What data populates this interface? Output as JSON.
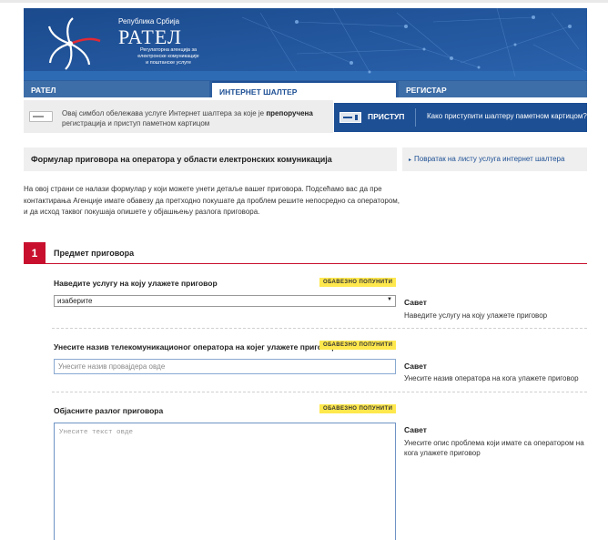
{
  "header": {
    "republic": "Република Србија",
    "agency_name": "РАТЕЛ",
    "agency_sub": [
      "Регулаторна агенција за",
      "електронске комуникације",
      "и поштанске услуге"
    ]
  },
  "tabs": [
    {
      "label": "РАТЕЛ"
    },
    {
      "label": "ИНТЕРНЕТ ШАЛТЕР"
    },
    {
      "label": "РЕГИСТАР"
    }
  ],
  "infobar": {
    "text_a": "Овај симбол обележава услуге Интернет шалтера за које је ",
    "text_bold": "препоручена",
    "text_b": " регистрација и приступ паметном картицом"
  },
  "login": {
    "button": "ПРИСТУП",
    "help": "Како приступити шалтеру паметном картицом?"
  },
  "page": {
    "title": "Формулар приговора на оператора у области електронских комуникација",
    "back_link": "Повратак на листу услуга интернет шалтера",
    "intro": "На овој страни се налази формулар у који можете унети детаље вашег приговора. Подсећамо вас да пре контактирања Агенције имате обавезу да претходно покушате да проблем решите непосредно са оператором, и да исход таквог покушаја опишете у објашњењу разлога приговора."
  },
  "section": {
    "number": "1",
    "title": "Предмет приговора"
  },
  "required_badge": "ОБАВЕЗНО ПОПУНИТИ",
  "fields": {
    "service": {
      "label": "Наведите услугу на коју улажете приговор",
      "selected": "изаберите",
      "tip_title": "Савет",
      "tip": "Наведите услугу на коју улажете приговор"
    },
    "operator": {
      "label": "Унесите назив телекомуникационог оператора на којег улажете приговор",
      "placeholder": "Унесите назив провајдера овде",
      "tip_title": "Савет",
      "tip": "Унесите назив оператора на кога улажете приговор"
    },
    "reason": {
      "label": "Објасните разлог приговора",
      "placeholder": "Унесите текст овде",
      "tip_title": "Савет",
      "tip": "Унесите опис проблема који имате са оператором на кога улажете приговор"
    }
  },
  "colors": {
    "brand_blue": "#1d4f94",
    "accent_red": "#c8102e",
    "required_yellow": "#ffe84d"
  }
}
